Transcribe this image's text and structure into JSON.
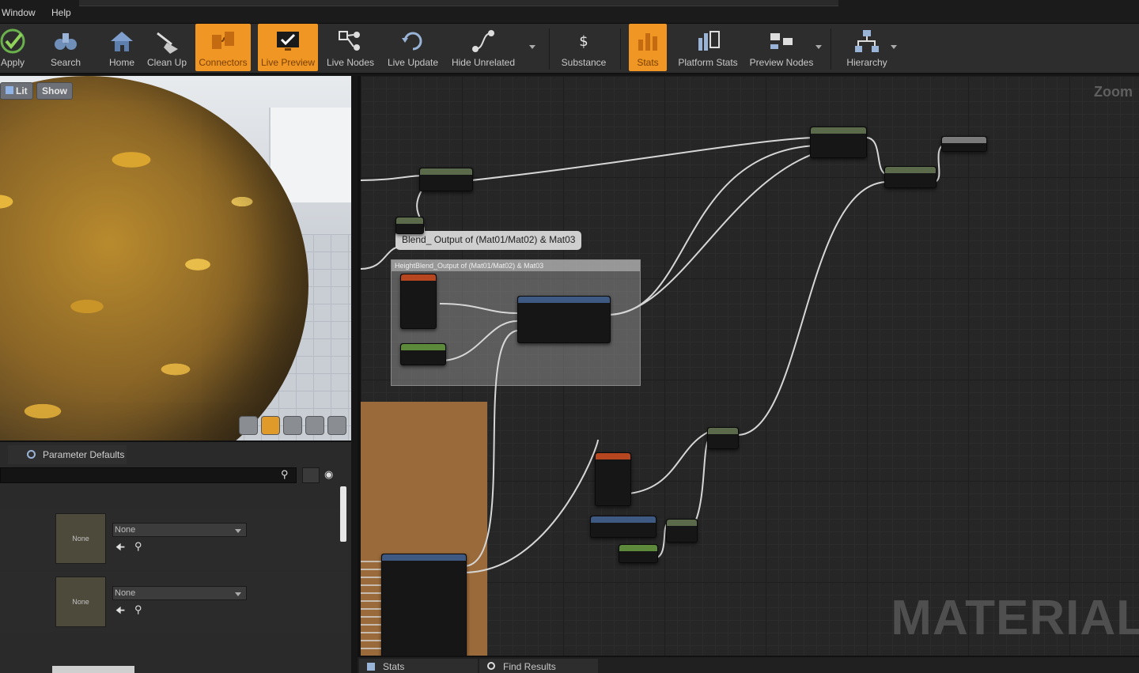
{
  "menu": {
    "window": "Window",
    "help": "Help"
  },
  "toolbar": {
    "apply": "Apply",
    "search": "Search",
    "home": "Home",
    "clean_up": "Clean Up",
    "connectors": "Connectors",
    "live_preview": "Live Preview",
    "live_nodes": "Live Nodes",
    "live_update": "Live Update",
    "hide_unrelated": "Hide Unrelated",
    "substance": "Substance",
    "stats": "Stats",
    "platform_stats": "Platform Stats",
    "preview_nodes": "Preview Nodes",
    "hierarchy": "Hierarchy",
    "accent_color": "#f09624"
  },
  "viewport": {
    "lit": "Lit",
    "show": "Show"
  },
  "params": {
    "tab_label": "Parameter Defaults",
    "rows": [
      {
        "thumb": "None",
        "value": "None"
      },
      {
        "thumb": "None",
        "value": "None"
      }
    ]
  },
  "graph": {
    "zoom_label": "Zoom",
    "watermark": "MATERIAL",
    "comment_title": "Blend_ Output of (Mat01/Mat02) & Mat03",
    "comment_group": "HeightBlend_Output of (Mat01/Mat02) & Mat03"
  },
  "bottom": {
    "stats": "Stats",
    "find_results": "Find Results"
  }
}
